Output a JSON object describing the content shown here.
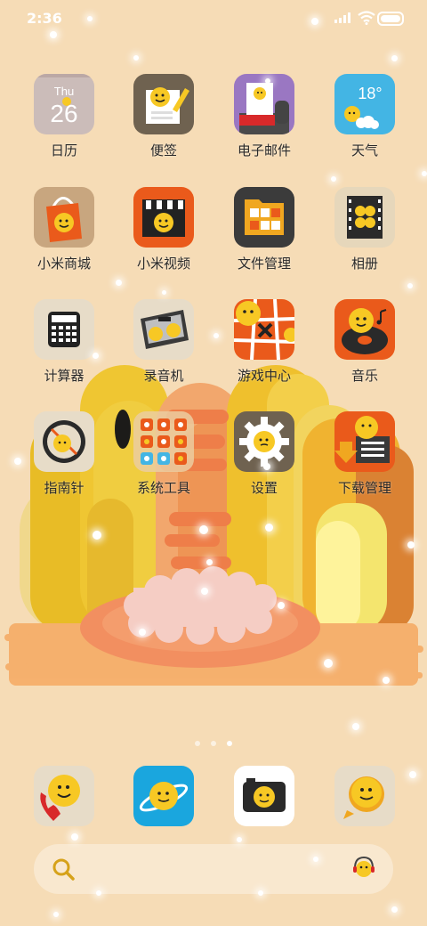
{
  "status_bar": {
    "time": "2:36"
  },
  "apps": [
    {
      "id": "calendar",
      "label": "日历",
      "icon": "calendar-icon",
      "day": "Thu",
      "date": "26"
    },
    {
      "id": "notes",
      "label": "便签",
      "icon": "notes-icon"
    },
    {
      "id": "email",
      "label": "电子邮件",
      "icon": "email-icon"
    },
    {
      "id": "weather",
      "label": "天气",
      "icon": "weather-icon",
      "temp": "18°"
    },
    {
      "id": "mall",
      "label": "小米商城",
      "icon": "shopping-bag-icon"
    },
    {
      "id": "video",
      "label": "小米视频",
      "icon": "video-clapper-icon"
    },
    {
      "id": "files",
      "label": "文件管理",
      "icon": "folder-icon"
    },
    {
      "id": "gallery",
      "label": "相册",
      "icon": "film-gallery-icon"
    },
    {
      "id": "calculator",
      "label": "计算器",
      "icon": "calculator-icon"
    },
    {
      "id": "recorder",
      "label": "录音机",
      "icon": "tape-recorder-icon"
    },
    {
      "id": "games",
      "label": "游戏中心",
      "icon": "game-grid-icon"
    },
    {
      "id": "music",
      "label": "音乐",
      "icon": "music-record-icon"
    },
    {
      "id": "compass",
      "label": "指南针",
      "icon": "compass-icon"
    },
    {
      "id": "tools",
      "label": "系统工具",
      "icon": "tools-folder-icon"
    },
    {
      "id": "settings",
      "label": "设置",
      "icon": "gear-icon"
    },
    {
      "id": "downloads",
      "label": "下载管理",
      "icon": "download-icon"
    }
  ],
  "page_indicator": {
    "count": 3,
    "active_index": 2
  },
  "dock": [
    {
      "id": "phone",
      "icon": "phone-icon"
    },
    {
      "id": "browser",
      "icon": "browser-planet-icon"
    },
    {
      "id": "camera",
      "icon": "camera-icon"
    },
    {
      "id": "messages",
      "icon": "message-bubble-icon"
    }
  ],
  "search_bar": {
    "icon": "search-icon",
    "assistant_icon": "voice-assistant-icon"
  },
  "colors": {
    "background": "#f6dcb6",
    "smiley": "#f7c824",
    "accent_orange": "#ea5a1b",
    "label_text": "#2a2a2a"
  }
}
